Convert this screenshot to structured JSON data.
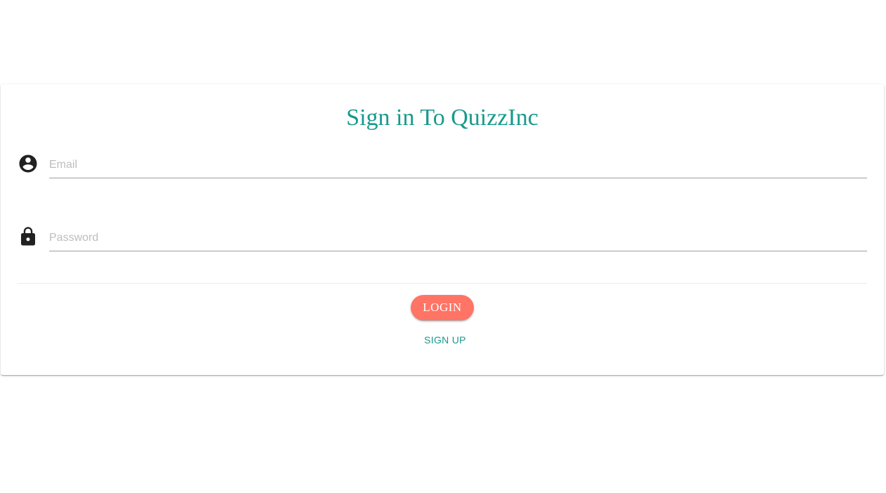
{
  "login": {
    "title": "Sign in To QuizzInc",
    "email": {
      "placeholder": "Email",
      "value": "",
      "icon": "account-circle-icon"
    },
    "password": {
      "placeholder": "Password",
      "value": "",
      "icon": "lock-icon"
    },
    "login_label": "LOGIN",
    "signup_label": "SIGN UP"
  },
  "colors": {
    "accent": "#179a8c",
    "login_button": "#ff7465",
    "icon": "#212121",
    "underline": "#9e9e9e"
  }
}
